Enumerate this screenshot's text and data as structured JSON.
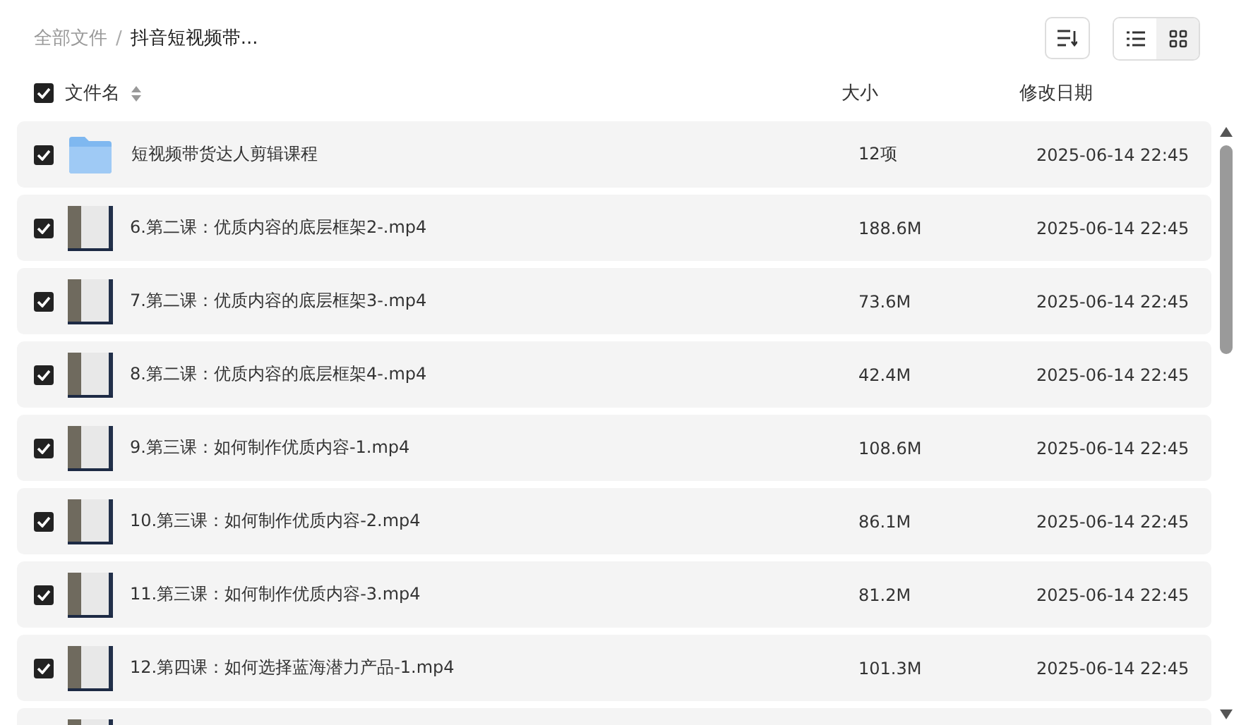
{
  "breadcrumb_separator": "/",
  "breadcrumb": [
    {
      "label": "全部文件",
      "current": false
    },
    {
      "label": "抖音短视频带...",
      "current": true
    }
  ],
  "view_toggle": [
    {
      "kind": "list",
      "selected": false
    },
    {
      "kind": "grid",
      "selected": true
    }
  ],
  "table": {
    "all_checked": true,
    "columns": [
      "文件名",
      "大小",
      "修改日期"
    ],
    "rows": [
      {
        "kind": "folder",
        "checked": true,
        "name": "短视频带货达人剪辑课程",
        "size": "12项",
        "date": "2025-06-14 22:45"
      },
      {
        "kind": "video",
        "checked": true,
        "name": "6.第二课：优质内容的底层框架2-.mp4",
        "size": "188.6M",
        "date": "2025-06-14 22:45"
      },
      {
        "kind": "video",
        "checked": true,
        "name": "7.第二课：优质内容的底层框架3-.mp4",
        "size": "73.6M",
        "date": "2025-06-14 22:45"
      },
      {
        "kind": "video",
        "checked": true,
        "name": "8.第二课：优质内容的底层框架4-.mp4",
        "size": "42.4M",
        "date": "2025-06-14 22:45"
      },
      {
        "kind": "video",
        "checked": true,
        "name": "9.第三课：如何制作优质内容-1.mp4",
        "size": "108.6M",
        "date": "2025-06-14 22:45"
      },
      {
        "kind": "video",
        "checked": true,
        "name": "10.第三课：如何制作优质内容-2.mp4",
        "size": "86.1M",
        "date": "2025-06-14 22:45"
      },
      {
        "kind": "video",
        "checked": true,
        "name": "11.第三课：如何制作优质内容-3.mp4",
        "size": "81.2M",
        "date": "2025-06-14 22:45"
      },
      {
        "kind": "video",
        "checked": true,
        "name": "12.第四课：如何选择蓝海潜力产品-1.mp4",
        "size": "101.3M",
        "date": "2025-06-14 22:45"
      },
      {
        "kind": "video"
      }
    ]
  }
}
